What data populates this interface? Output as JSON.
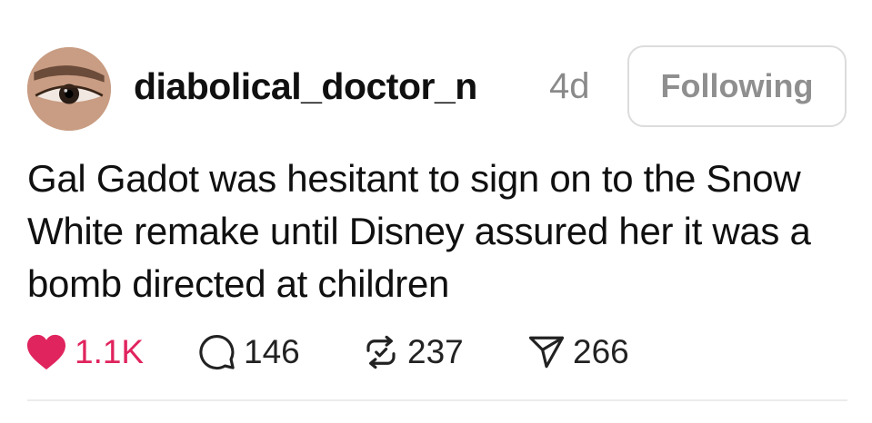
{
  "post": {
    "username": "diabolical_doctor_n",
    "timestamp": "4d",
    "follow_label": "Following",
    "text": "Gal Gadot was hesitant to sign on to the Snow White remake until Disney assured her it was a bomb directed at children"
  },
  "actions": {
    "likes": "1.1K",
    "replies": "146",
    "reposts": "237",
    "shares": "266"
  },
  "icons": {
    "like": "heart-icon",
    "reply": "comment-icon",
    "repost": "repost-icon",
    "share": "share-icon"
  },
  "colors": {
    "like_accent": "#e0245e",
    "muted_text": "#8a8a8a",
    "text": "#101010"
  }
}
